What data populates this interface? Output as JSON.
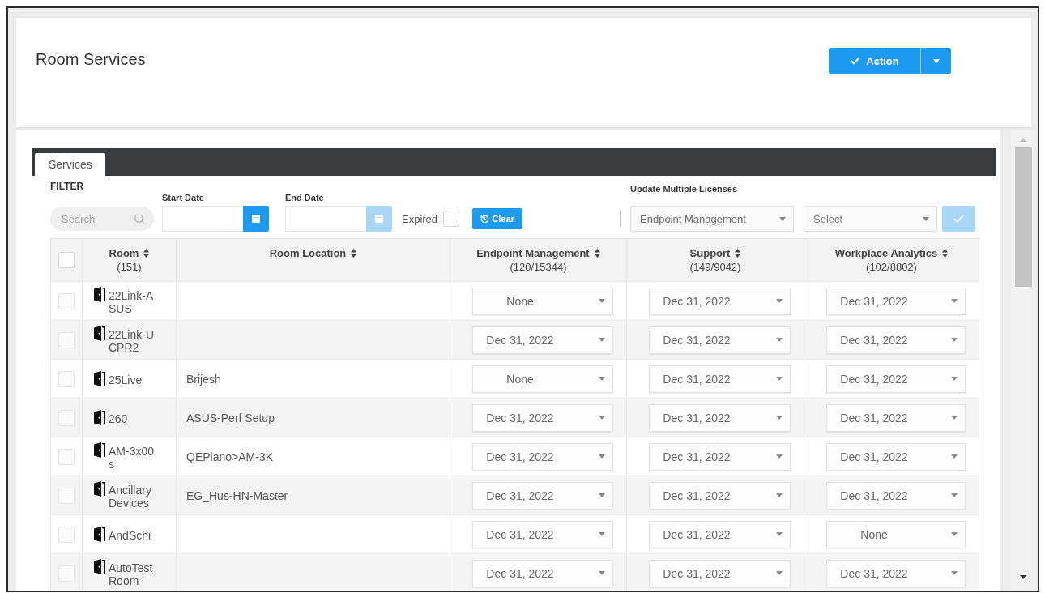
{
  "header": {
    "title": "Room Services",
    "action_button": {
      "label": "Action"
    }
  },
  "tabs": [
    {
      "label": "Services",
      "selected": true
    }
  ],
  "filter": {
    "heading": "FILTER",
    "search": {
      "placeholder": "Search"
    },
    "start_date": {
      "label": "Start Date",
      "disabled": false
    },
    "end_date": {
      "label": "End Date",
      "disabled": true
    },
    "expired": {
      "label": "Expired",
      "checked": false
    },
    "clear_button": {
      "label": "Clear"
    }
  },
  "bulk_update": {
    "heading": "Update Multiple Licenses",
    "license_type": {
      "value": "Endpoint Management"
    },
    "expiry": {
      "placeholder": "Select"
    },
    "apply_button": {
      "disabled": true
    }
  },
  "table": {
    "select_all": {
      "checked": false
    },
    "columns": [
      {
        "label": "Room",
        "count": "(151)"
      },
      {
        "label": "Room Location"
      },
      {
        "label": "Endpoint Management",
        "count": "(120/15344)"
      },
      {
        "label": "Support",
        "count": "(149/9042)"
      },
      {
        "label": "Workplace Analytics",
        "count": "(102/8802)"
      }
    ],
    "rows": [
      {
        "checked": false,
        "room": "22Link-ASUS",
        "licenses": [
          "None",
          "Dec 31, 2022",
          "Dec 31, 2022"
        ]
      },
      {
        "checked": false,
        "room": "22Link-UCPR2",
        "licenses": [
          "Dec 31, 2022",
          "Dec 31, 2022",
          "Dec 31, 2022"
        ]
      },
      {
        "checked": false,
        "room": "25Live",
        "location": "Brijesh",
        "licenses": [
          "None",
          "Dec 31, 2022",
          "Dec 31, 2022"
        ]
      },
      {
        "checked": false,
        "room": "260",
        "location": "ASUS-Perf Setup",
        "licenses": [
          "Dec 31, 2022",
          "Dec 31, 2022",
          "Dec 31, 2022"
        ]
      },
      {
        "checked": false,
        "room": "AM-3x00s",
        "location": "QEPlano>AM-3K",
        "licenses": [
          "Dec 31, 2022",
          "Dec 31, 2022",
          "Dec 31, 2022"
        ]
      },
      {
        "checked": false,
        "room": "Ancillary Devices",
        "location": "EG_Hus-HN-Master",
        "licenses": [
          "Dec 31, 2022",
          "Dec 31, 2022",
          "Dec 31, 2022"
        ]
      },
      {
        "checked": false,
        "room": "AndSchi",
        "licenses": [
          "Dec 31, 2022",
          "Dec 31, 2022",
          "None"
        ]
      },
      {
        "checked": false,
        "room": "AutoTest Room",
        "licenses": [
          "Dec 31, 2022",
          "Dec 31, 2022",
          "Dec 31, 2022"
        ]
      }
    ]
  }
}
